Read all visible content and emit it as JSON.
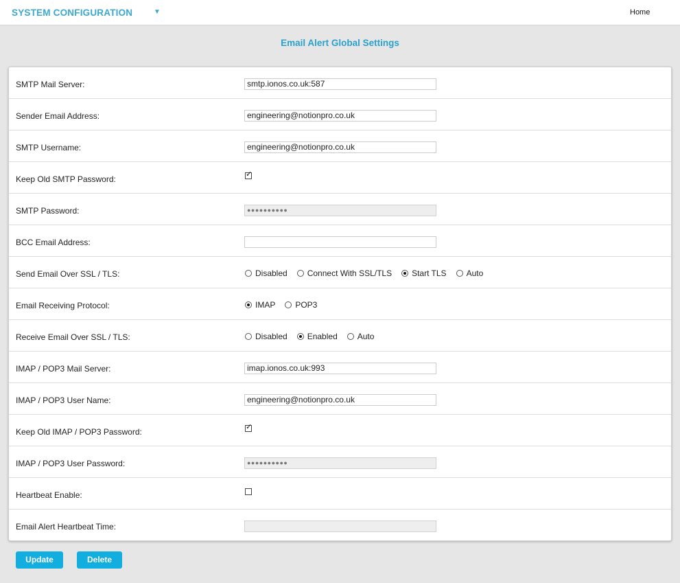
{
  "header": {
    "title": "SYSTEM CONFIGURATION",
    "home_link": "Home"
  },
  "page_title": "Email Alert Global Settings",
  "fields": {
    "smtp_server": {
      "label": "SMTP Mail Server:",
      "value": "smtp.ionos.co.uk:587"
    },
    "sender_email": {
      "label": "Sender Email Address:",
      "value": "engineering@notionpro.co.uk"
    },
    "smtp_username": {
      "label": "SMTP Username:",
      "value": "engineering@notionpro.co.uk"
    },
    "keep_old_smtp_password": {
      "label": "Keep Old SMTP Password:",
      "checked": true
    },
    "smtp_password": {
      "label": "SMTP Password:",
      "value": "●●●●●●●●●●"
    },
    "bcc_email": {
      "label": "BCC Email Address:",
      "value": ""
    },
    "send_ssl_tls": {
      "label": "Send Email Over SSL / TLS:",
      "options": [
        "Disabled",
        "Connect With SSL/TLS",
        "Start TLS",
        "Auto"
      ],
      "selected": "Start TLS"
    },
    "receiving_protocol": {
      "label": "Email Receiving Protocol:",
      "options": [
        "IMAP",
        "POP3"
      ],
      "selected": "IMAP"
    },
    "receive_ssl_tls": {
      "label": "Receive Email Over SSL / TLS:",
      "options": [
        "Disabled",
        "Enabled",
        "Auto"
      ],
      "selected": "Enabled"
    },
    "imap_server": {
      "label": "IMAP / POP3 Mail Server:",
      "value": "imap.ionos.co.uk:993"
    },
    "imap_username": {
      "label": "IMAP / POP3 User Name:",
      "value": "engineering@notionpro.co.uk"
    },
    "keep_old_imap_password": {
      "label": "Keep Old IMAP / POP3 Password:",
      "checked": true
    },
    "imap_password": {
      "label": "IMAP / POP3 User Password:",
      "value": "●●●●●●●●●●"
    },
    "heartbeat_enable": {
      "label": "Heartbeat Enable:",
      "checked": false
    },
    "heartbeat_time": {
      "label": "Email Alert Heartbeat Time:",
      "value": ""
    }
  },
  "buttons": {
    "update": "Update",
    "delete": "Delete"
  },
  "colors": {
    "accent": "#3aa8d0",
    "button": "#12aee0"
  }
}
